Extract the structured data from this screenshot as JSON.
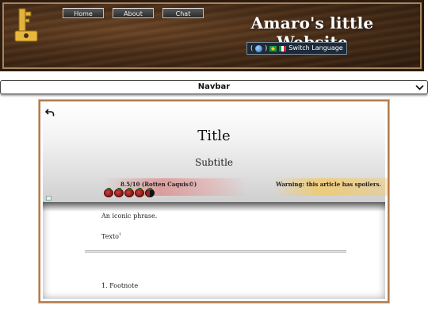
{
  "header": {
    "site_title": "Amaro's little Website",
    "nav": [
      {
        "label": "Home"
      },
      {
        "label": "About"
      },
      {
        "label": "Chat"
      }
    ],
    "language_button": {
      "prefix": "(",
      "suffix": ")",
      "label": "Switch Language"
    }
  },
  "navbar": {
    "label": "Navbar"
  },
  "article": {
    "title": "Title",
    "subtitle": "Subtitle",
    "rating": {
      "text": "8.5/10 (Rotten Caquis©)",
      "value": 8.5,
      "max": 10
    },
    "spoiler_warning": "Warning: this article has spoilers.",
    "phrase": "An iconic phrase.",
    "body_text": "Texto",
    "footnote_ref": "1",
    "footnote": "1. Footnote"
  },
  "colors": {
    "header_wood": "#4a2e18",
    "header_border": "#a9845a",
    "article_border": "#b07c50",
    "rating_band": "#e16e6e",
    "spoiler_band": "#f5c85a"
  }
}
